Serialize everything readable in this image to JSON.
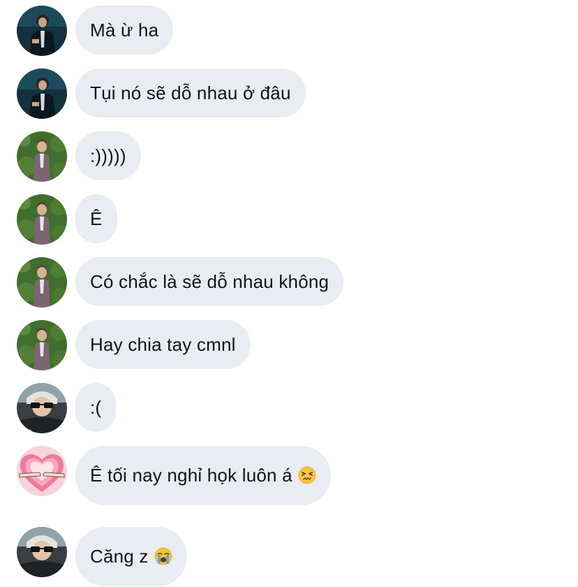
{
  "messages": [
    {
      "sender": "dark-suit-user",
      "text": "Mà ừ ha"
    },
    {
      "sender": "dark-suit-user",
      "text": "Tụi nó sẽ dỗ nhau ở đâu"
    },
    {
      "sender": "hedge-user",
      "text": ":)))))"
    },
    {
      "sender": "hedge-user",
      "text": "Ê"
    },
    {
      "sender": "hedge-user",
      "text": "Có chắc là sẽ dỗ nhau không"
    },
    {
      "sender": "hedge-user",
      "text": "Hay chia tay cmnl"
    },
    {
      "sender": "sunglasses-user",
      "text": ":("
    },
    {
      "sender": "heart-user",
      "text": "Ê tối nay nghỉ họk luôn á",
      "emoji": "confounded-face-emoji"
    },
    {
      "sender": "sunglasses-user",
      "text": "Căng z",
      "emoji": "loudly-crying-face-emoji"
    }
  ],
  "colors": {
    "bubble_bg": "#e9ecf0",
    "text": "#111418",
    "background": "#ffffff"
  }
}
